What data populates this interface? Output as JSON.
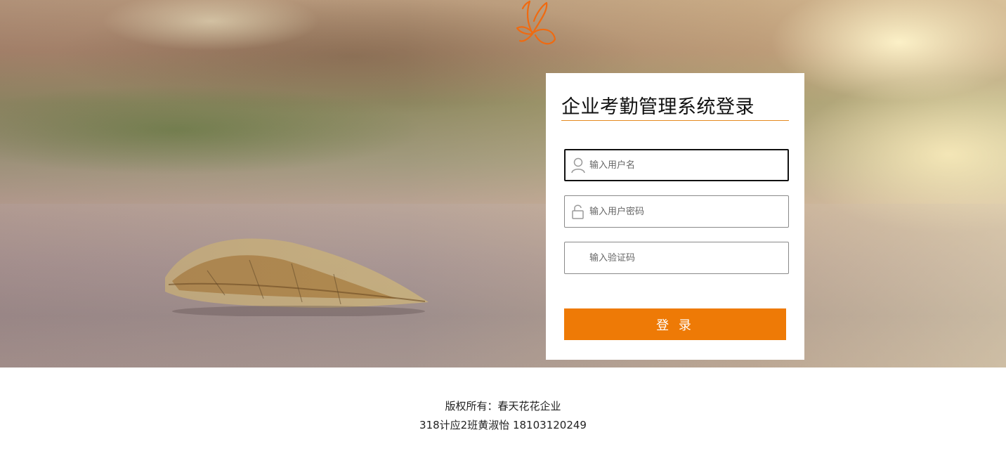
{
  "login": {
    "title": "企业考勤管理系统登录",
    "username_placeholder": "输入用户名",
    "password_placeholder": "输入用户密码",
    "captcha_placeholder": "输入验证码",
    "submit_label": "登 录"
  },
  "footer": {
    "copyright": "版权所有：春天花花企业",
    "author": "318计应2班黄淑怡 18103120249"
  },
  "icons": {
    "logo": "butterfly-icon",
    "username": "user-icon",
    "password": "lock-icon"
  },
  "colors": {
    "accent": "#ee7a06",
    "title_underline": "#e58a20"
  }
}
